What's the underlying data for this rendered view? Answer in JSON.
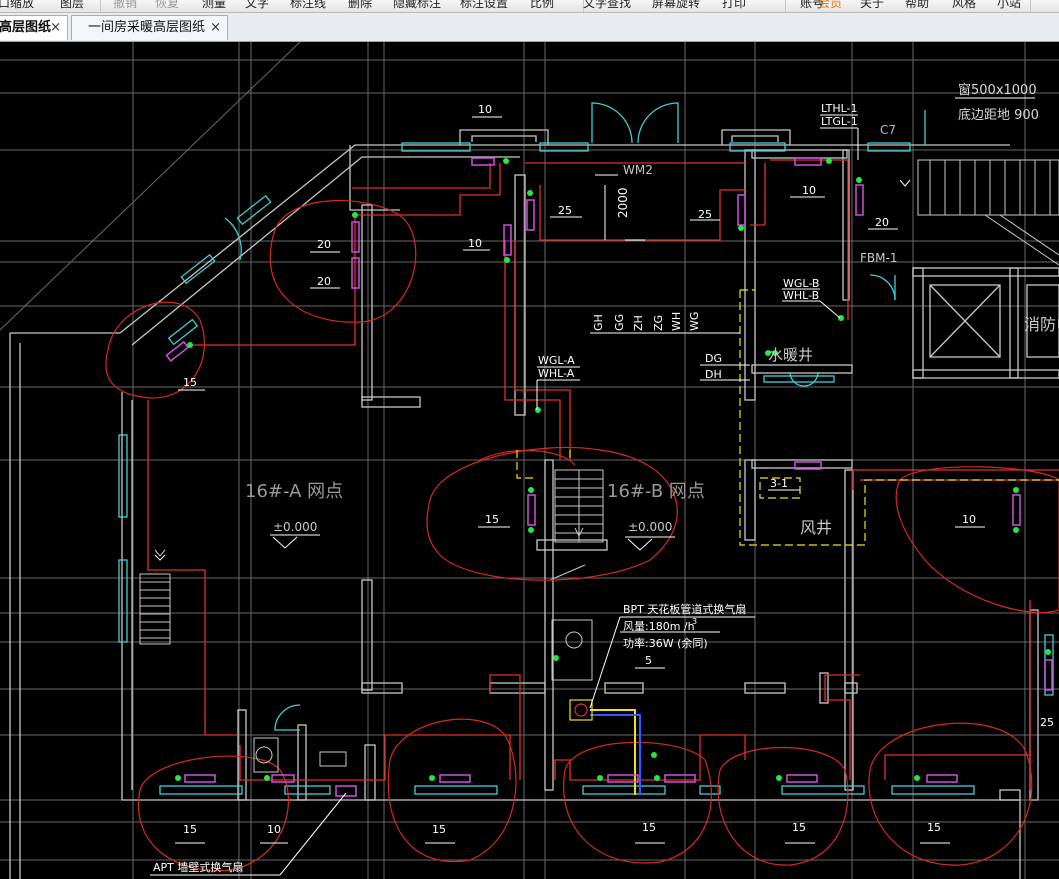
{
  "menubar": {
    "items": [
      {
        "label": "窗口缩放",
        "state": "normal"
      },
      {
        "label": "图层",
        "state": "normal"
      },
      {
        "label": "撤销",
        "state": "disabled"
      },
      {
        "label": "恢复",
        "state": "disabled"
      },
      {
        "label": "测量",
        "state": "normal"
      },
      {
        "label": "文字",
        "state": "normal"
      },
      {
        "label": "标注线",
        "state": "normal"
      },
      {
        "label": "删除",
        "state": "normal"
      },
      {
        "label": "隐藏标注",
        "state": "normal"
      },
      {
        "label": "标注设置",
        "state": "normal"
      },
      {
        "label": "比例",
        "state": "normal"
      },
      {
        "label": "文字查找",
        "state": "normal"
      },
      {
        "label": "屏幕旋转",
        "state": "normal"
      },
      {
        "label": "打印",
        "state": "normal"
      },
      {
        "label": "账号",
        "state": "normal"
      },
      {
        "label": "会员",
        "state": "highlight"
      },
      {
        "label": "关于",
        "state": "normal"
      },
      {
        "label": "帮助",
        "state": "normal"
      },
      {
        "label": "风格",
        "state": "normal"
      },
      {
        "label": "小站",
        "state": "normal"
      }
    ]
  },
  "tabs": [
    {
      "label": "高层图纸",
      "close": "×",
      "active": true
    },
    {
      "label": "一间房采暖高层图纸",
      "close": "×",
      "active": false
    }
  ],
  "drawing": {
    "colors": {
      "background": "#000000",
      "grid": "#8c8c8c",
      "wall": "#bdbdbd",
      "pipe": "#e0302a",
      "cloud": "#d42a22",
      "window": "#3fd0d8",
      "radiator": "#d04de0",
      "valve": "#23e64a",
      "yellow": "#f2e11a",
      "text": "#ffffff",
      "blue": "#2a5cff"
    },
    "labels": {
      "window_spec_1": "窗500x1000",
      "window_spec_2": "底边距地  900",
      "lthl": "LTHL-1",
      "ltgl": "LTGL-1",
      "c7": "C7",
      "n10_top": "10",
      "wm2": "WM2",
      "dim_2000": "2000",
      "n25_a": "25",
      "n25_b": "25",
      "n10_stair": "10",
      "n20_right": "20",
      "fbm1": "FBM-1",
      "n20_a": "20",
      "n20_b": "20",
      "n10_mid": "10",
      "wgl_b": "WGL-B",
      "whl_b": "WHL-B",
      "shaft_gh": "GH",
      "shaft_gg": "GG",
      "shaft_zh": "ZH",
      "shaft_zg": "ZG",
      "shaft_wh": "WH",
      "shaft_wg": "WG",
      "dg": "DG",
      "dh": "DH",
      "water_shaft": "水暖井",
      "fire": "消防电",
      "wgl_a": "WGL-A",
      "whl_a": "WHL-A",
      "n15_left": "15",
      "room_a": "16#-A 网点",
      "level_a": "±0.000",
      "room_b": "16#-B 网点",
      "level_b": "±0.000",
      "n15_mid": "15",
      "n3_1": "3-1",
      "air_shaft": "风井",
      "n10_right": "10",
      "bpt": "BPT 天花板管道式换气扇",
      "bpt_air": "风量:180m /h",
      "bpt_power": "功率:36W   (余同)",
      "n5": "5",
      "n25_edge": "25",
      "n15_b1": "15",
      "n10_b2": "10",
      "n15_b3": "15",
      "n15_b4": "15",
      "n15_b5": "15",
      "n15_b6": "15",
      "apt": "APT 墙壁式换气扇"
    }
  }
}
